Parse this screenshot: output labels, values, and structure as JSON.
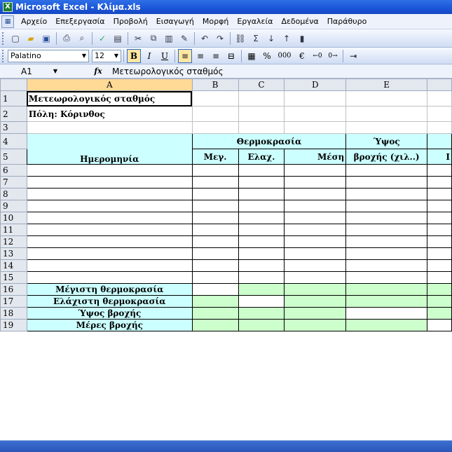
{
  "window": {
    "title": "Microsoft Excel - Κλίμα.xls"
  },
  "menu": [
    "Αρχείο",
    "Επεξεργασία",
    "Προβολή",
    "Εισαγωγή",
    "Μορφή",
    "Εργαλεία",
    "Δεδομένα",
    "Παράθυρο"
  ],
  "format_toolbar": {
    "font_name": "Palatino",
    "font_size": "12",
    "percent": "%",
    "thousands": "000",
    "currency": "€"
  },
  "formula_bar": {
    "name_box": "A1",
    "fx_label": "fx",
    "value": "Μετεωρολογικός σταθμός"
  },
  "columns": [
    "A",
    "B",
    "C",
    "D",
    "E"
  ],
  "rows": [
    "1",
    "2",
    "3",
    "4",
    "5",
    "6",
    "7",
    "8",
    "9",
    "10",
    "11",
    "12",
    "13",
    "14",
    "15",
    "16",
    "17",
    "18",
    "19"
  ],
  "cells": {
    "a1": "Μετεωρολογικός σταθμός",
    "a2": "Πόλη: Κόρινθος",
    "temp_header": "Θερμοκρασία",
    "rain_header_1": "Ύψος",
    "rain_header_2": "βροχής (χιλ..)",
    "date_header": "Ημερομηνία",
    "max": "Μεγ.",
    "min": "Ελαχ.",
    "avg": "Μέση",
    "f_cut": "Ι",
    "r16": "Μέγιστη θερμοκρασία",
    "r17": "Ελάχιστη θερμοκρασία",
    "r18": "Ύψος βροχής",
    "r19": "Μέρες βροχής"
  },
  "colors": {
    "header_fill": "#ccffff",
    "summary_fill": "#ccffcc",
    "title_bar": "#1a55d8"
  }
}
